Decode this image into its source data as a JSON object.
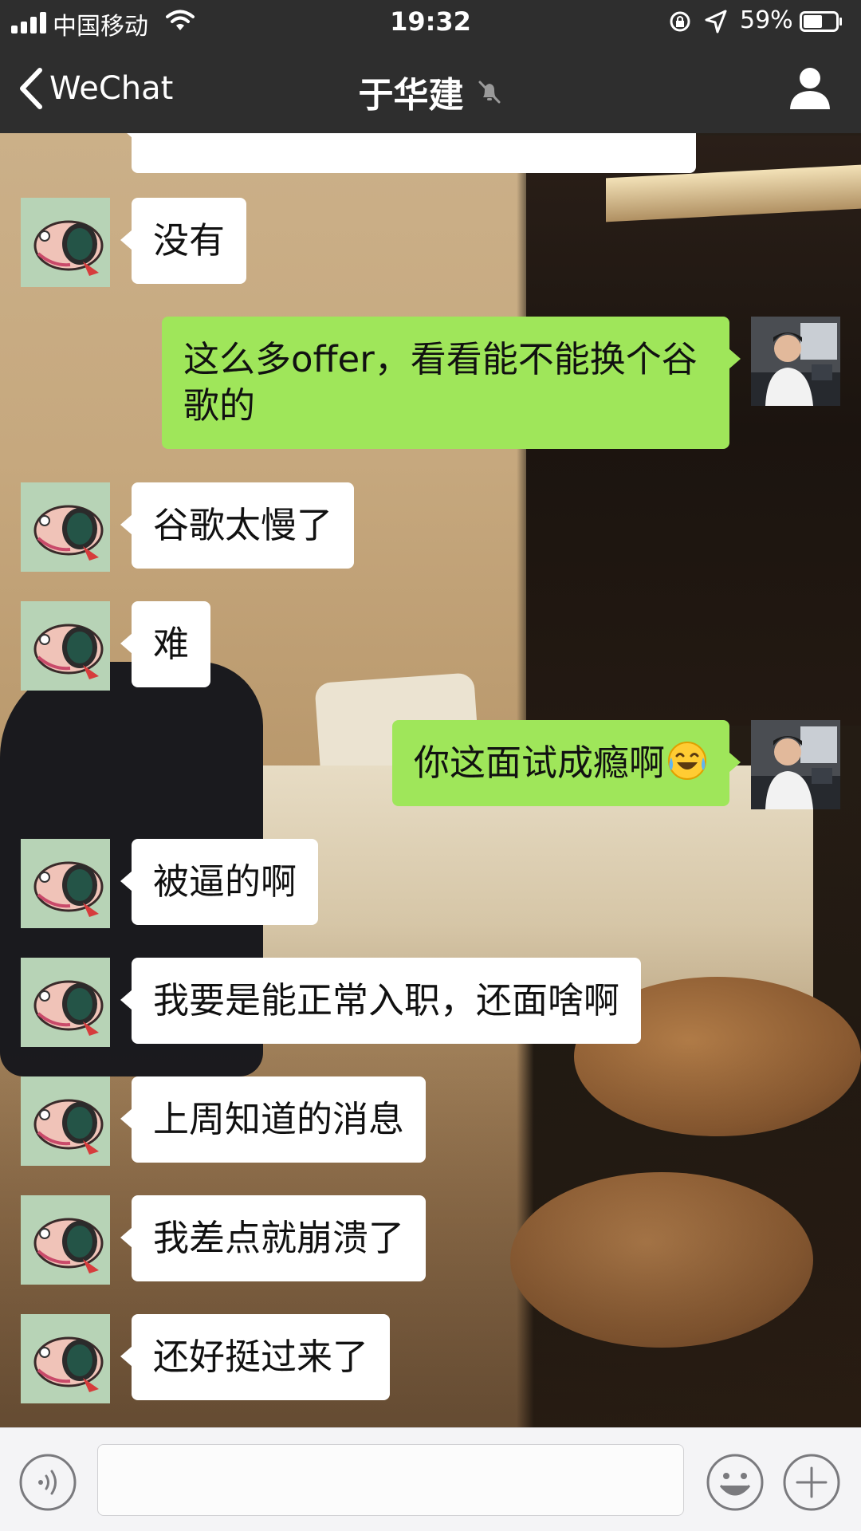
{
  "status_bar": {
    "carrier": "中国移动",
    "time": "19:32",
    "battery": "59%",
    "battery_level": 0.59
  },
  "nav": {
    "back_label": "WeChat",
    "title": "于华建",
    "muted": true
  },
  "messages": [
    {
      "side": "left",
      "text": "没有"
    },
    {
      "side": "right",
      "text": "这么多offer，看看能不能换个谷歌的"
    },
    {
      "side": "left",
      "text": "谷歌太慢了"
    },
    {
      "side": "left",
      "text": "难"
    },
    {
      "side": "right",
      "text": "你这面试成瘾啊",
      "emoji": "laugh-cry-emoji"
    },
    {
      "side": "left",
      "text": "被逼的啊"
    },
    {
      "side": "left",
      "text": "我要是能正常入职，还面啥啊"
    },
    {
      "side": "left",
      "text": "上周知道的消息"
    },
    {
      "side": "left",
      "text": "我差点就崩溃了"
    },
    {
      "side": "left",
      "text": "还好挺过来了"
    }
  ],
  "input": {
    "value": "",
    "placeholder": ""
  },
  "colors": {
    "bar_bg": "#2e2e2e",
    "my_bubble": "#9fe65a",
    "friend_bubble": "#ffffff",
    "input_bar_bg": "#f4f4f6"
  },
  "icons": {
    "back": "chevron-left-icon",
    "mute": "bell-muted-icon",
    "profile": "person-icon",
    "voice": "voice-icon",
    "emoji": "smiley-icon",
    "more": "plus-icon"
  }
}
